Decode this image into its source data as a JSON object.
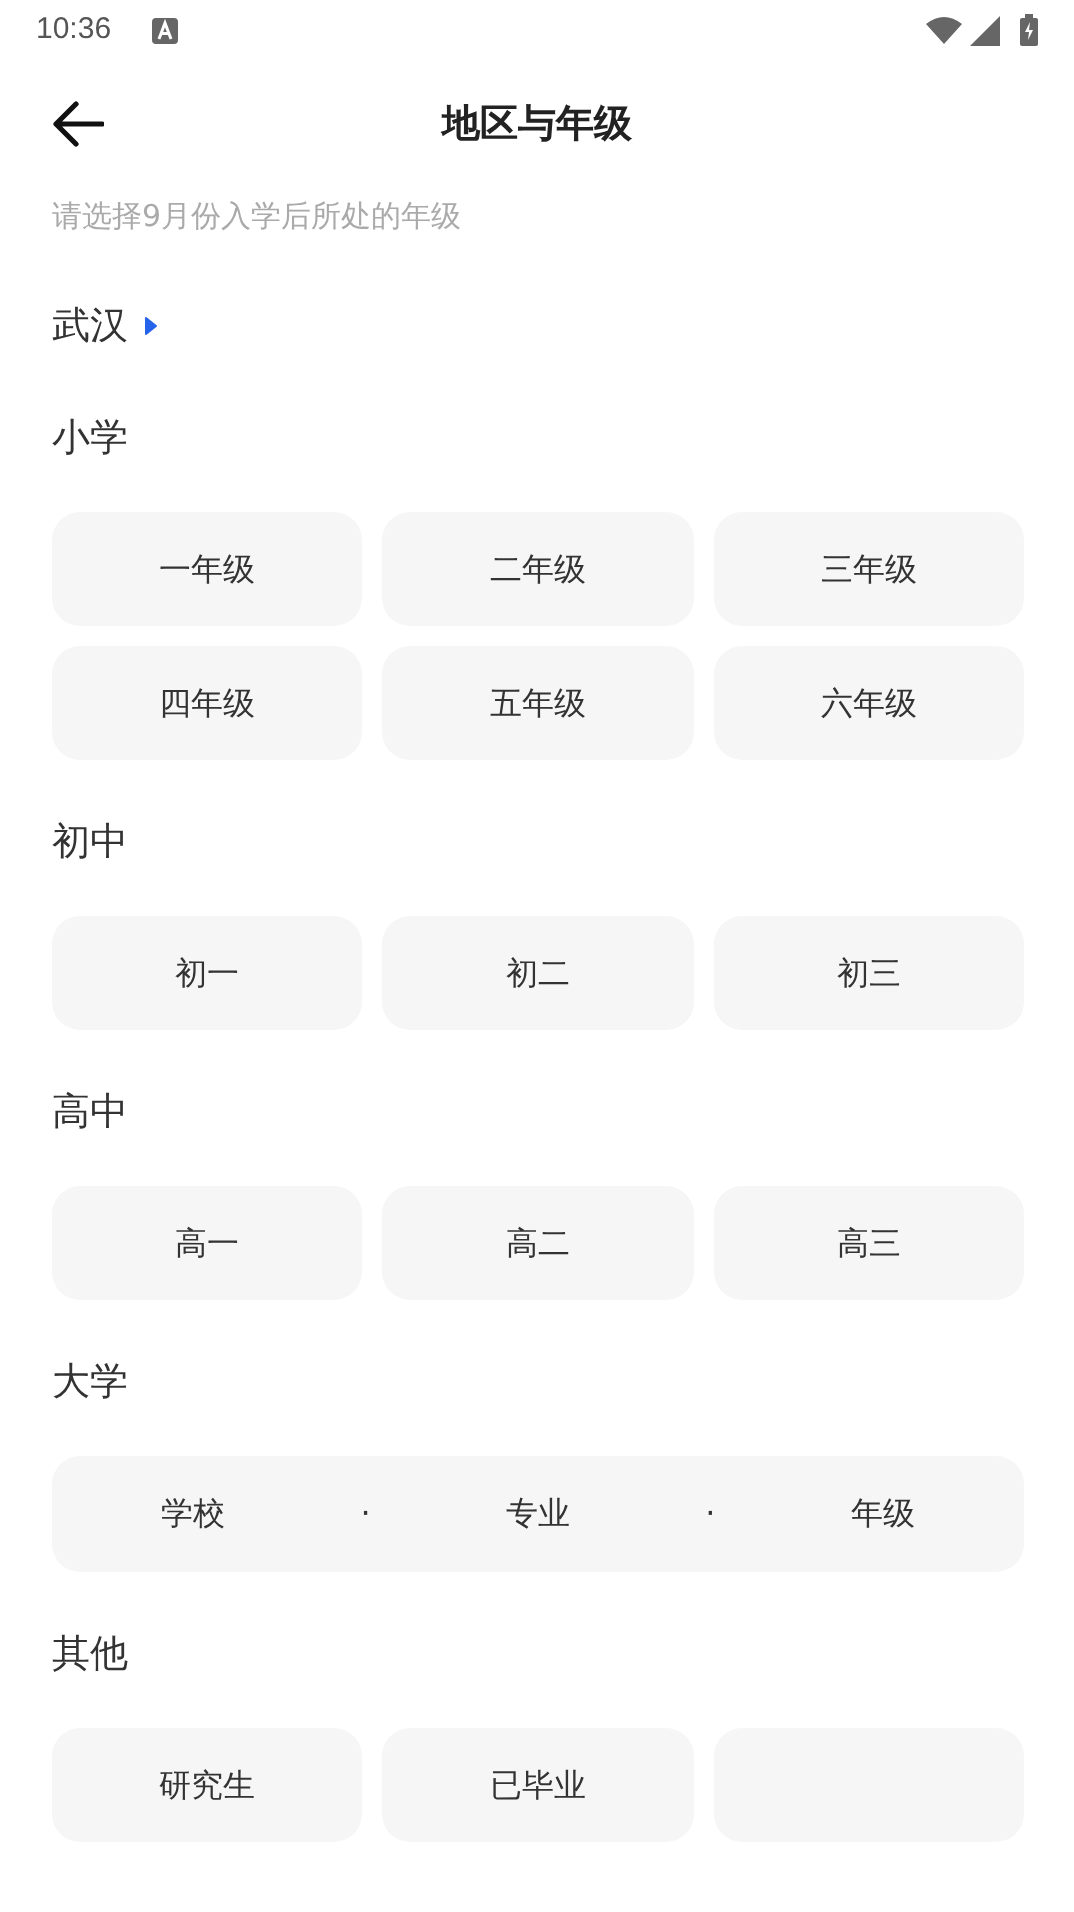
{
  "status_bar": {
    "time": "10:36"
  },
  "header": {
    "title": "地区与年级"
  },
  "hint": "请选择9月份入学后所处的年级",
  "region": {
    "name": "武汉"
  },
  "sections": [
    {
      "title": "小学",
      "kind": "grid",
      "options": [
        {
          "kind": "label",
          "label": "一年级"
        },
        {
          "kind": "label",
          "label": "二年级"
        },
        {
          "kind": "label",
          "label": "三年级"
        },
        {
          "kind": "label",
          "label": "四年级"
        },
        {
          "kind": "label",
          "label": "五年级"
        },
        {
          "kind": "label",
          "label": "六年级"
        }
      ]
    },
    {
      "title": "初中",
      "kind": "grid",
      "options": [
        {
          "kind": "label",
          "label": "初一"
        },
        {
          "kind": "label",
          "label": "初二"
        },
        {
          "kind": "label",
          "label": "初三"
        }
      ]
    },
    {
      "title": "高中",
      "kind": "grid",
      "options": [
        {
          "kind": "label",
          "label": "高一"
        },
        {
          "kind": "label",
          "label": "高二"
        },
        {
          "kind": "label",
          "label": "高三"
        }
      ]
    },
    {
      "title": "大学",
      "kind": "picker",
      "parts": [
        "学校",
        "·",
        "专业",
        "·",
        "年级"
      ]
    },
    {
      "title": "其他",
      "kind": "grid",
      "options": [
        {
          "kind": "label",
          "label": "研究生"
        },
        {
          "kind": "label",
          "label": "已毕业"
        },
        {
          "kind": "blank"
        }
      ]
    }
  ]
}
